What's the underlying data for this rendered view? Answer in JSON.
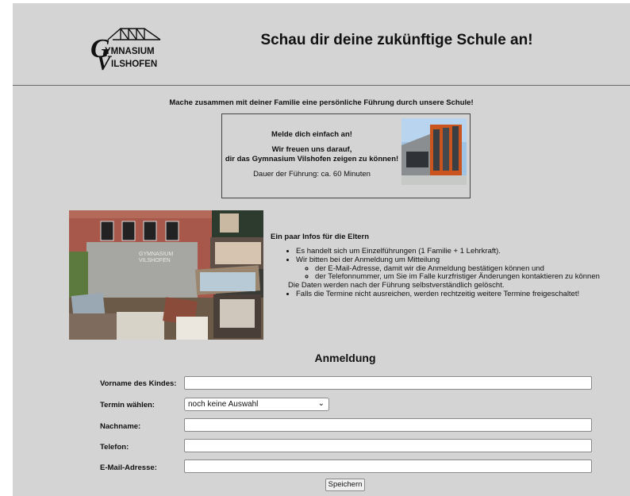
{
  "header": {
    "logo_text": "Gymnasium Vilshofen",
    "logo_line1": "YMNASIUM",
    "logo_line2": "ILSHOFEN",
    "headline": "Schau dir deine zukünftige Schule an!"
  },
  "intro": "Mache zusammen mit deiner Familie eine persönliche Führung durch unsere Schule!",
  "signup_box": {
    "line1": "Melde dich einfach an!",
    "line2": "Wir freuen uns darauf,",
    "line3": "dir das Gymnasium Vilshofen zeigen zu können!",
    "duration": "Dauer der Führung: ca. 60 Minuten"
  },
  "collage": {
    "building_text_1": "GYMNASIUM",
    "building_text_2": "VILSHOFEN"
  },
  "info": {
    "title": "Ein paar Infos für die Eltern",
    "item1": "Es handelt sich um Einzelführungen (1 Familie + 1 Lehrkraft).",
    "item2": "Wir bitten bei der Anmeldung um Mitteilung",
    "sub1": "der E-Mail-Adresse, damit wir die Anmeldung bestätigen können und",
    "sub2": "der Telefonnummer, um Sie im Falle kurzfristiger Änderungen kontaktieren zu können",
    "note": "Die Daten werden nach der Führung selbstverständlich gelöscht.",
    "item3": "Falls die Termine nicht ausreichen, werden rechtzeitig weitere Termine freigeschaltet!"
  },
  "form": {
    "title": "Anmeldung",
    "vorname_label": "Vorname des Kindes:",
    "vorname_value": "",
    "termin_label": "Termin wählen:",
    "termin_selected": "noch keine Auswahl",
    "nachname_label": "Nachname:",
    "nachname_value": "",
    "telefon_label": "Telefon:",
    "telefon_value": "",
    "email_label": "E-Mail-Adresse:",
    "email_value": "",
    "save_label": "Speichern"
  },
  "icons": {
    "chevron": "chevron-down-icon"
  }
}
